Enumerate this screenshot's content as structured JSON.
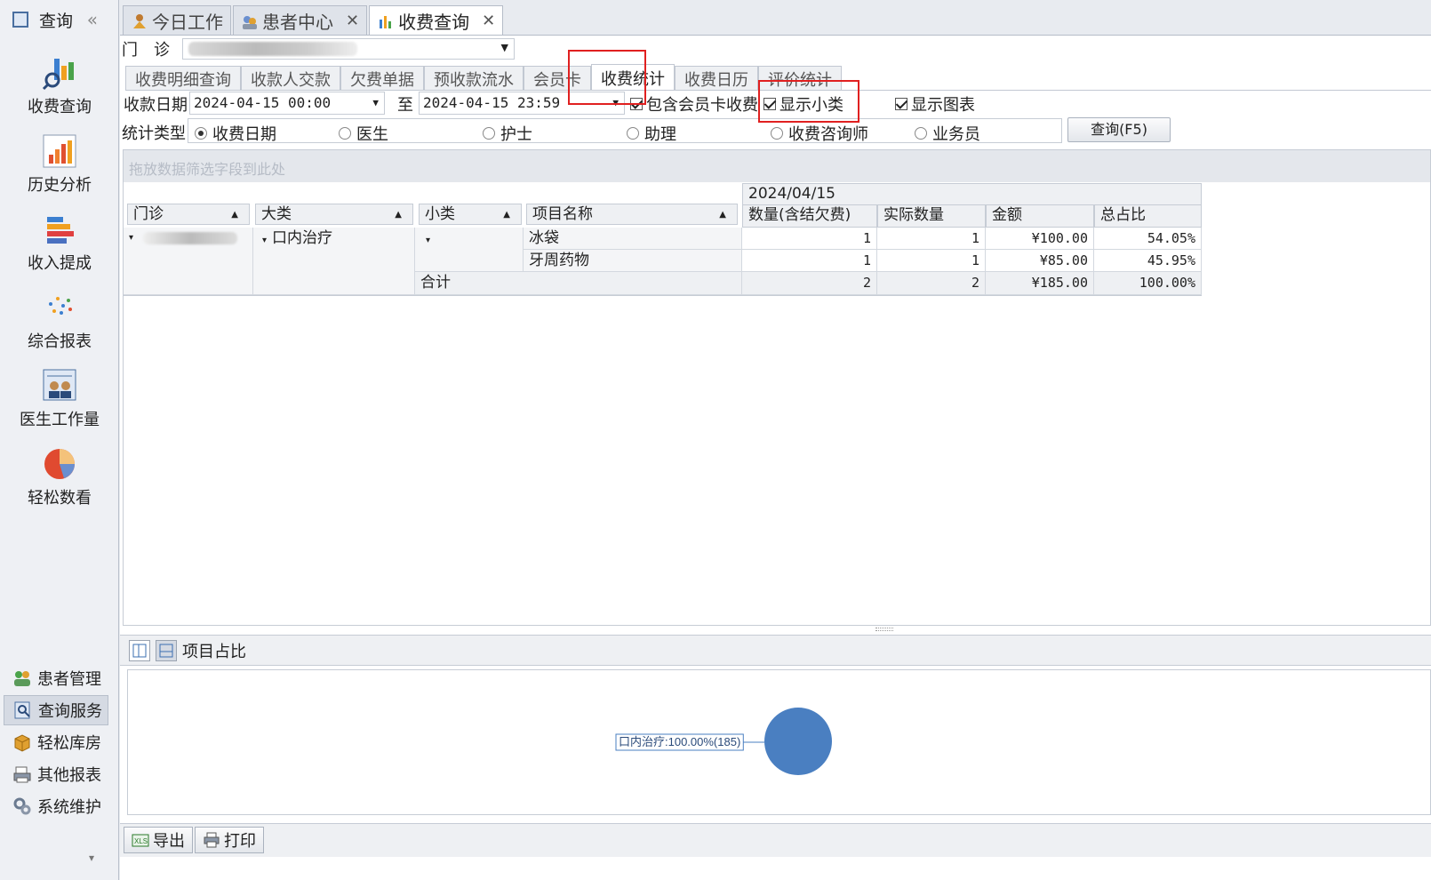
{
  "sidebar": {
    "title": "查询",
    "collapse_glyph": "«",
    "big_items": [
      {
        "label": "收费查询",
        "icon": "search-chart-icon"
      },
      {
        "label": "历史分析",
        "icon": "bar-chart-icon"
      },
      {
        "label": "收入提成",
        "icon": "stacked-bars-icon"
      },
      {
        "label": "综合报表",
        "icon": "scatter-dots-icon"
      },
      {
        "label": "医生工作量",
        "icon": "doctor-workload-icon"
      },
      {
        "label": "轻松数看",
        "icon": "pie-chart-icon"
      }
    ],
    "small_items": [
      {
        "label": "患者管理",
        "icon": "people-icon"
      },
      {
        "label": "查询服务",
        "icon": "search-doc-icon",
        "active": true
      },
      {
        "label": "轻松库房",
        "icon": "box-icon"
      },
      {
        "label": "其他报表",
        "icon": "printer-report-icon"
      },
      {
        "label": "系统维护",
        "icon": "gears-icon"
      }
    ],
    "more_glyph": "▾"
  },
  "doc_tabs": [
    {
      "label": "今日工作",
      "icon": "worker-icon",
      "closable": false,
      "active": false
    },
    {
      "label": "患者中心",
      "icon": "patients-icon",
      "closable": true,
      "active": false
    },
    {
      "label": "收费查询",
      "icon": "chart-icon",
      "closable": true,
      "active": true
    }
  ],
  "clinic": {
    "label": "门　诊"
  },
  "sub_tabs": [
    "收费明细查询",
    "收款人交款",
    "欠费单据",
    "预收款流水",
    "会员卡",
    "收费统计",
    "收费日历",
    "评价统计"
  ],
  "active_sub_tab": "收费统计",
  "filters": {
    "date_label": "收款日期",
    "date_from": "2024-04-15 00:00",
    "to_label": "至",
    "date_to": "2024-04-15 23:59",
    "include_member": "包含会员卡收费",
    "show_subclass": "显示小类",
    "show_chart": "显示图表",
    "stat_type_label": "统计类型",
    "stat_options": [
      "收费日期",
      "医生",
      "护士",
      "助理",
      "收费咨询师",
      "业务员"
    ],
    "stat_selected": "收费日期",
    "query_button": "查询(F5)"
  },
  "pivot": {
    "drop_hint": "拖放数据筛选字段到此处",
    "row_fields": [
      "门诊",
      "大类",
      "小类",
      "项目名称"
    ],
    "date_header": "2024/04/15",
    "data_fields": [
      "数量(含结欠费)",
      "实际数量",
      "金额",
      "总占比"
    ],
    "category": "口内治疗",
    "rows": [
      {
        "item": "冰袋",
        "qty": "1",
        "actual": "1",
        "amount": "¥100.00",
        "pct": "54.05%"
      },
      {
        "item": "牙周药物",
        "qty": "1",
        "actual": "1",
        "amount": "¥85.00",
        "pct": "45.95%"
      }
    ],
    "total": {
      "label": "合计",
      "qty": "2",
      "actual": "2",
      "amount": "¥185.00",
      "pct": "100.00%"
    }
  },
  "chart": {
    "title": "项目占比",
    "label": "口内治疗:100.00%(185)",
    "color": "#4a7fc1"
  },
  "chart_data": {
    "type": "pie",
    "categories": [
      "口内治疗"
    ],
    "values": [
      185
    ],
    "percent": [
      100.0
    ],
    "title": "项目占比"
  },
  "toolbar": {
    "export": "导出",
    "print": "打印"
  },
  "colors": {
    "highlight": "#e02020",
    "pie": "#4a7fc1"
  }
}
